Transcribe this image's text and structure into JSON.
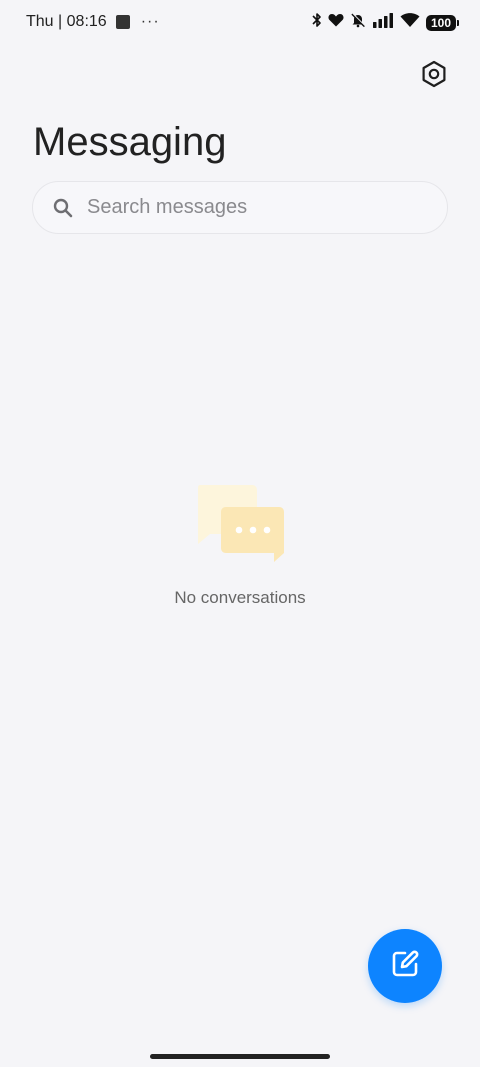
{
  "status_bar": {
    "day": "Thu",
    "separator": "|",
    "time": "08:16",
    "overflow": "···",
    "battery_level": "100",
    "icons": [
      "bluetooth-icon",
      "heart-icon",
      "bell-off-icon",
      "signal-icon",
      "wifi-icon",
      "battery-icon"
    ]
  },
  "header": {
    "title": "Messaging",
    "settings_icon": "settings-hexagon-icon"
  },
  "search": {
    "placeholder": "Search messages",
    "value": ""
  },
  "empty_state": {
    "illustration": "chat-bubbles-icon",
    "text": "No conversations"
  },
  "fab": {
    "icon": "compose-icon",
    "color": "#0d84ff"
  },
  "colors": {
    "background": "#f5f5f8",
    "accent": "#0d84ff",
    "illustration_back": "#fdf5dc",
    "illustration_front": "#fbe7b5"
  }
}
